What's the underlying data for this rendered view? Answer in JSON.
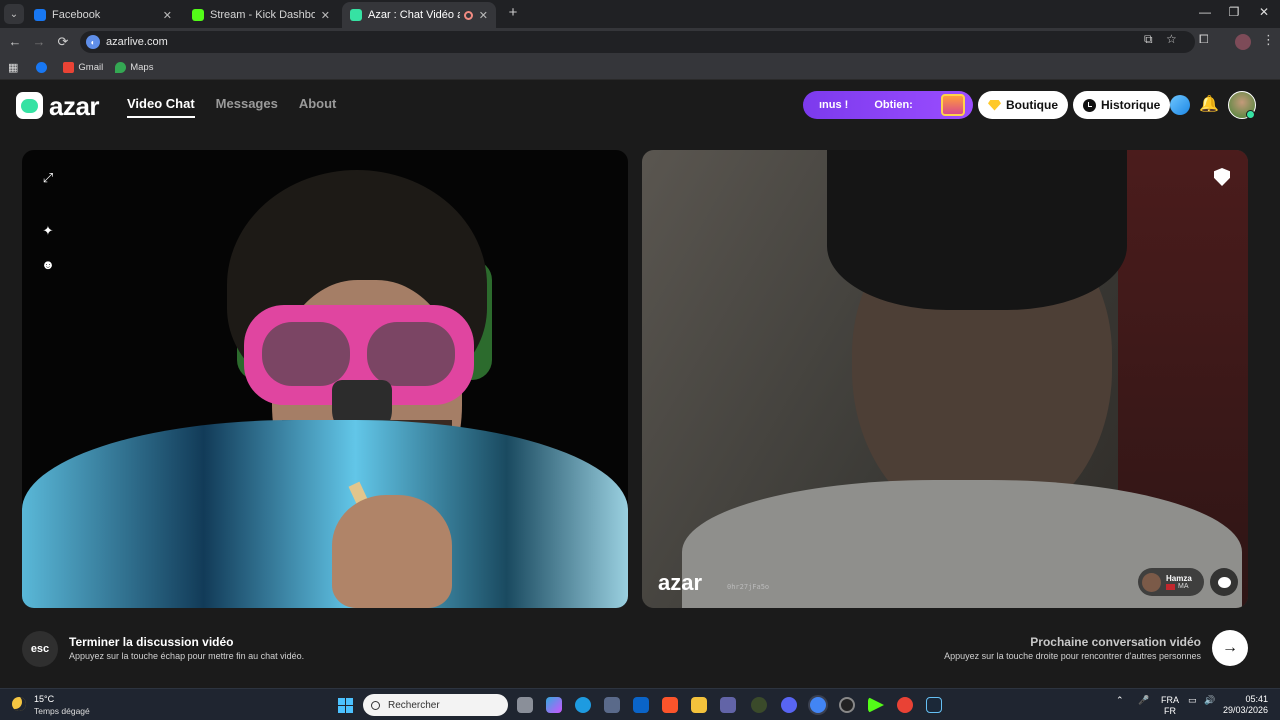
{
  "browser": {
    "tabs": [
      {
        "label": "Facebook",
        "fav_color": "#1877f2",
        "close": "✕"
      },
      {
        "label": "Stream - Kick Dashboard",
        "fav_color": "#53fc18",
        "close": "✕"
      },
      {
        "label": "Azar : Chat Vidéo avec de n",
        "fav_color": "#36e2a3",
        "close": "✕"
      }
    ],
    "new_tab": "+",
    "window_controls": [
      "—",
      "❐",
      "✕"
    ],
    "url": "azarlive.com",
    "bookmarks": [
      {
        "label": "",
        "color": "#1877f2"
      },
      {
        "label": "Gmail",
        "color": "#ea4335"
      },
      {
        "label": "Maps",
        "color": "#34a853"
      }
    ]
  },
  "header": {
    "logo_text": "azar",
    "nav": [
      "Video Chat",
      "Messages",
      "About"
    ],
    "promo": {
      "left_text": "ınus !",
      "right_text": "Obtien:"
    },
    "shop_label": "Boutique",
    "history_label": "Historique",
    "bell": "🔔"
  },
  "left_video": {
    "icons": {
      "expand": "⤢",
      "magic": "✦",
      "face": "☻"
    }
  },
  "right_video": {
    "watermark": "azar",
    "peer_id": "0hr27jFa5o",
    "peer": {
      "name": "Hamza",
      "country": "MA"
    }
  },
  "footer": {
    "esc_key": "esc",
    "end_title": "Terminer la discussion vidéo",
    "end_hint": "Appuyez sur la touche échap pour mettre fin au chat vidéo.",
    "next_title": "Prochaine conversation vidéo",
    "next_hint": "Appuyez sur la touche droite pour rencontrer d'autres personnes",
    "next_arrow": "→"
  },
  "taskbar": {
    "temperature": "15°C",
    "weather": "Temps dégagé",
    "search_placeholder": "Rechercher",
    "lang_top": "FRA",
    "lang_bottom": "FR",
    "time": "05:41",
    "date": "29/03/2026"
  }
}
